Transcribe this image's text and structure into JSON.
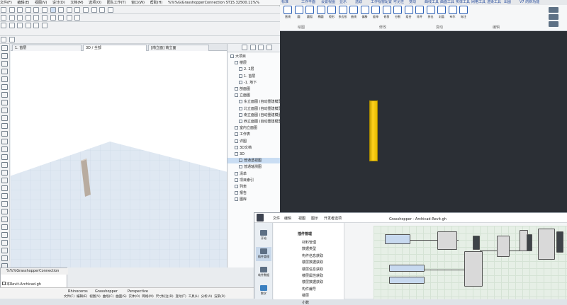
{
  "archicad": {
    "menu": [
      "文件(F)",
      "编辑(E)",
      "视图(V)",
      "设计(D)",
      "文档(M)",
      "选项(O)",
      "团队工作(T)",
      "窗口(W)",
      "帮助(H)"
    ],
    "title_path": "%%%G\\GrasshopperConnection ST15.32500.11%%",
    "tabs": [
      "1. 首层",
      "3D / 全部",
      "[南立面] 南立面"
    ],
    "navigator": [
      "大项目",
      "楼层",
      "2. 2层",
      "1. 首层",
      "-1. 地下",
      "剖面图",
      "立面图",
      "东立面图 (自动重建模型)",
      "北立面图 (自动重建模型)",
      "南立面图 (自动重建模型)",
      "西立面图 (自动重建模型)",
      "室内立面图",
      "工作表",
      "详图",
      "3D文档",
      "3D",
      "普通透视图",
      "普通轴测图",
      "清单",
      "项目索引",
      "列表",
      "报告",
      "图库"
    ],
    "bottom_window_title": "%%%GrasshopperConnection",
    "bottom_file": "本Revit-Archicad.gh"
  },
  "rhino": {
    "ribbon_tabs": [
      "标准",
      "工作平面",
      "设置视图",
      "显示",
      "选取",
      "工作视窗配置",
      "可见性",
      "变动",
      "曲线工具",
      "曲面工具",
      "实体工具",
      "网格工具",
      "渲染工具",
      "出图",
      "V7 的新功能"
    ],
    "buttons": [
      "直线",
      "圆",
      "圆弧",
      "椭圆",
      "矩形",
      "多边形",
      "曲线",
      "偏移",
      "延伸",
      "修剪",
      "分割",
      "组合",
      "炸开",
      "挤出",
      "封盖",
      "布尔",
      "标注"
    ],
    "groups": [
      "绘图",
      "修改",
      "变动",
      "编辑"
    ],
    "bottom_bar": [
      "Rhinoceros",
      "Grasshopper",
      "Perspective"
    ],
    "bottom_menu": [
      "文件(F)",
      "编辑(E)",
      "视图(V)",
      "曲线(C)",
      "曲面(S)",
      "实体(O)",
      "网格(M)",
      "尺寸标注(D)",
      "变动(T)",
      "工具(L)",
      "分析(A)",
      "渲染(R)"
    ]
  },
  "grasshopper": {
    "menu": [
      "文件",
      "编辑",
      "视图",
      "图示",
      "开发者选项"
    ],
    "path_title": "Grasshopper - Archicad-Revit.gh",
    "side": [
      "开始",
      "插件管理",
      "软件数据",
      "数学"
    ],
    "list_header": "插件管理",
    "list_items": [
      "材料管理",
      "数据类型",
      "构件信息获取",
      "楼层数据获取",
      "楼层信息获取",
      "楼层属性获取",
      "楼层数据获取",
      "构件编号",
      "楼层",
      "小数"
    ]
  }
}
